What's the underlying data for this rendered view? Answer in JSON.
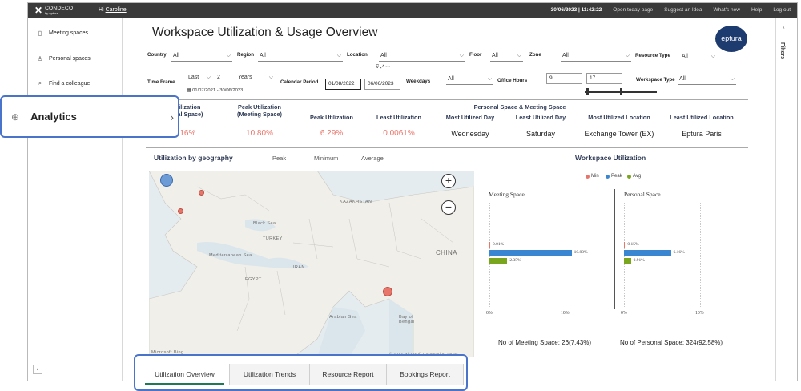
{
  "topbar": {
    "brand": "CONDECO",
    "brand_sub": "by eptura",
    "greeting_prefix": "Hi",
    "user": "Caroline",
    "datetime": "30/06/2023 | 11:42:22",
    "links": [
      "Open today page",
      "Suggest an Idea",
      "What's new",
      "Help",
      "Log out"
    ]
  },
  "sidebar": {
    "items": [
      {
        "label": "Meeting spaces",
        "icon": "door-icon"
      },
      {
        "label": "Personal spaces",
        "icon": "person-icon"
      },
      {
        "label": "Find a colleague",
        "icon": "search-icon"
      }
    ],
    "highlight": {
      "label": "Analytics",
      "icon": "magnify-chart-icon"
    },
    "collapse_label": "‹"
  },
  "filters_panel": {
    "label": "Filters",
    "arrow": "‹"
  },
  "report": {
    "title": "Workspace Utilization & Usage Overview",
    "logo_text": "eptura",
    "filters": {
      "country_label": "Country",
      "country_value": "All",
      "region_label": "Region",
      "region_value": "All",
      "location_label": "Location",
      "location_value": "All",
      "floor_label": "Floor",
      "floor_value": "All",
      "zone_label": "Zone",
      "zone_value": "All",
      "resource_type_label": "Resource Type",
      "resource_type_value": "All",
      "time_frame_label": "Time Frame",
      "time_frame_mode": "Last",
      "time_frame_count": "2",
      "time_frame_unit": "Years",
      "date_range": "01/07/2021 - 30/06/2023",
      "calendar_period_label": "Calendar Period",
      "calendar_start": "01/08/2022",
      "calendar_end": "06/06/2023",
      "weekdays_label": "Weekdays",
      "weekdays_value": "All",
      "office_hours_label": "Office Hours",
      "office_hours_start": "9",
      "office_hours_end": "17",
      "workspace_type_label": "Workspace Type",
      "workspace_type_value": "All"
    },
    "kpi_group_title": "Personal Space & Meeting Space",
    "kpis": [
      {
        "head1": "Utilization",
        "head2": "onal Space)",
        "value": ".16%"
      },
      {
        "head1": "Peak Utilization",
        "head2": "(Meeting Space)",
        "value": "10.80%"
      },
      {
        "head1": "Peak Utilization",
        "head2": "",
        "value": "6.29%"
      },
      {
        "head1": "Least Utilization",
        "head2": "",
        "value": "0.0061%"
      },
      {
        "head1": "Most Utilized Day",
        "head2": "",
        "value": "Wednesday"
      },
      {
        "head1": "Least Utilized Day",
        "head2": "",
        "value": "Saturday"
      },
      {
        "head1": "Most Utilized Location",
        "head2": "",
        "value": "Exchange Tower (EX)"
      },
      {
        "head1": "Least Utilized Location",
        "head2": "",
        "value": "Eptura Paris"
      }
    ],
    "geo": {
      "title": "Utilization by geography",
      "tabs": [
        "Peak",
        "Minimum",
        "Average"
      ],
      "map_labels": [
        "KAZAKHSTAN",
        "Black Sea",
        "Mediterranean Sea",
        "Arabian Sea",
        "Bay of Bengal",
        "CHINA",
        "EGYPT",
        "IRAN",
        "TURKEY",
        "Microsoft Bing",
        "© 2023 Microsoft Corporation  Terms"
      ],
      "zoom_in": "+",
      "zoom_out": "−"
    },
    "workspace_util": {
      "title": "Workspace Utilization",
      "legend": [
        {
          "label": "Min",
          "color": "#e8756a"
        },
        {
          "label": "Peak",
          "color": "#3b86d1"
        },
        {
          "label": "Avg",
          "color": "#7aa51f"
        }
      ],
      "meeting_title": "Meeting Space",
      "personal_title": "Personal Space",
      "meeting_count": "No of Meeting Space: 26(7.43%)",
      "personal_count": "No of Personal Space: 324(92.58%)",
      "axis_min": "0%",
      "axis_max": "10%"
    },
    "tabs": [
      "Utilization Overview",
      "Utilization Trends",
      "Resource Report",
      "Bookings Report"
    ],
    "active_tab": "Utilization Overview"
  },
  "chart_data": [
    {
      "type": "bar",
      "title": "Meeting Space",
      "categories": [
        "Min",
        "Peak",
        "Avg"
      ],
      "values": [
        0.01,
        10.8,
        2.35
      ],
      "value_labels": [
        "0.01%",
        "10.80%",
        "2.35%"
      ],
      "xlim": [
        0,
        10
      ],
      "colors": [
        "#e8756a",
        "#3b86d1",
        "#7aa51f"
      ]
    },
    {
      "type": "bar",
      "title": "Personal Space",
      "categories": [
        "Min",
        "Peak",
        "Avg"
      ],
      "values": [
        0.15,
        6.16,
        0.91
      ],
      "value_labels": [
        "0.15%",
        "6.16%",
        "0.91%"
      ],
      "xlim": [
        0,
        10
      ],
      "colors": [
        "#e8756a",
        "#3b86d1",
        "#7aa51f"
      ]
    }
  ]
}
